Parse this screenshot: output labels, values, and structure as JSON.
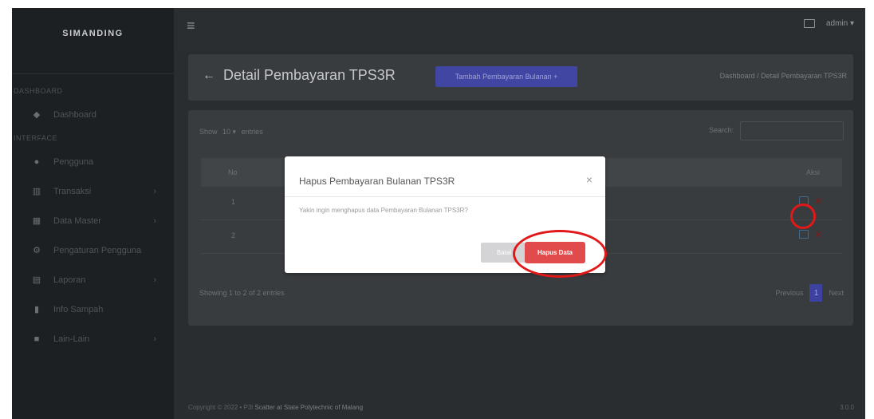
{
  "app": {
    "brand": "SIMANDING"
  },
  "sidebar": {
    "heading_1": "DASHBOARD",
    "heading_2": "INTERFACE",
    "items": [
      {
        "label": "Dashboard",
        "icon": "dashboard-icon",
        "has_children": false
      },
      {
        "label": "Pengguna",
        "icon": "users-icon",
        "has_children": false
      },
      {
        "label": "Transaksi",
        "icon": "chart-icon",
        "has_children": true
      },
      {
        "label": "Data Master",
        "icon": "table-icon",
        "has_children": true
      },
      {
        "label": "Pengaturan Pengguna",
        "icon": "settings-icon",
        "has_children": false
      },
      {
        "label": "Laporan",
        "icon": "report-icon",
        "has_children": true
      },
      {
        "label": "Info Sampah",
        "icon": "trash-icon",
        "has_children": false
      },
      {
        "label": "Lain-Lain",
        "icon": "folder-icon",
        "has_children": true
      }
    ]
  },
  "topbar": {
    "user": "admin ▾"
  },
  "page": {
    "title": "Detail Pembayaran TPS3R",
    "add_button": "Tambah Pembayaran Bulanan +",
    "breadcrumb": "Dashboard / Detail Pembayaran TPS3R"
  },
  "table": {
    "show_label": "Show",
    "show_value": "10 ▾",
    "entries_label": "entries",
    "search_label": "Search:",
    "col_no": "No",
    "col_aksi": "Aksi",
    "rows": [
      {
        "no": "1"
      },
      {
        "no": "2"
      }
    ],
    "info": "Showing 1 to 2 of 2 entries",
    "prev": "Previous",
    "page": "1",
    "next": "Next"
  },
  "footer": {
    "copyright": "Copyright © 2022 • P3l ",
    "org": "Scatter at State Polytechnic of Malang",
    "version": "3.0.0"
  },
  "modal": {
    "title": "Hapus Pembayaran Bulanan TPS3R",
    "close": "×",
    "body": "Yakin ingin menghapus data Pembayaran Bulanan TPS3R?",
    "back_label": "Batal",
    "delete_label": "Hapus Data"
  },
  "colors": {
    "highlight": "#e21717",
    "danger": "#e24b4b",
    "primary": "#4146a3"
  }
}
